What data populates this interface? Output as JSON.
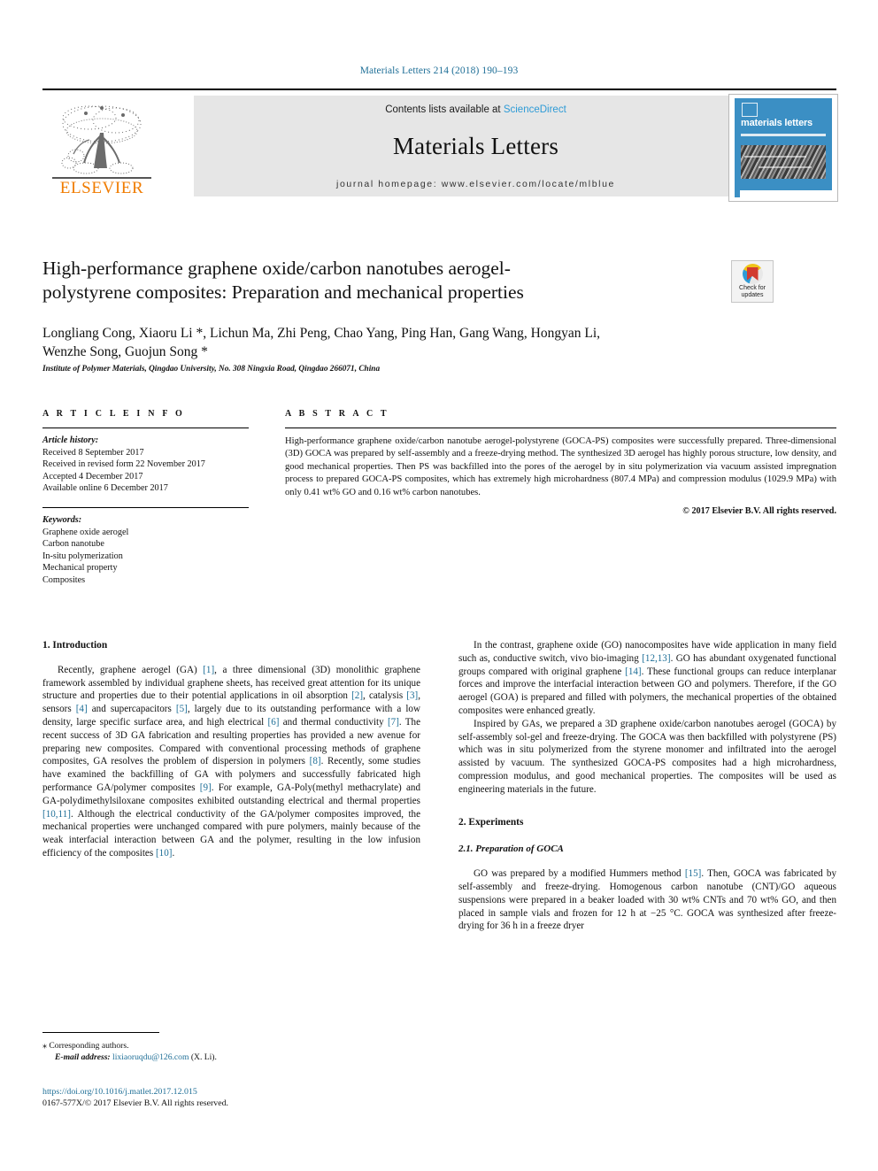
{
  "running_head": "Materials Letters 214 (2018) 190–193",
  "masthead": {
    "contents_prefix": "Contents lists available at ",
    "sciencedirect": "ScienceDirect",
    "journal_name": "Materials Letters",
    "homepage": "journal homepage: www.elsevier.com/locate/mlblue",
    "publisher_wordmark": "ELSEVIER",
    "cover_title": "materials letters",
    "accent_blue": "#2e9bd6",
    "elsevier_orange": "#f07c00"
  },
  "article": {
    "title_line1": "High-performance graphene oxide/carbon nanotubes aerogel-",
    "title_line2": "polystyrene composites: Preparation and mechanical properties",
    "authors_line1": "Longliang Cong, Xiaoru Li *, Lichun Ma, Zhi Peng, Chao Yang, Ping Han, Gang Wang, Hongyan Li,",
    "authors_line2": "Wenzhe Song, Guojun Song *",
    "affiliation": "Institute of Polymer Materials, Qingdao University, No. 308 Ningxia Road, Qingdao 266071, China",
    "crossmark_label_line1": "Check for",
    "crossmark_label_line2": "updates"
  },
  "article_info": {
    "heading": "A R T I C L E   I N F O",
    "history_label": "Article history:",
    "history": [
      "Received 8 September 2017",
      "Received in revised form 22 November 2017",
      "Accepted 4 December 2017",
      "Available online 6 December 2017"
    ],
    "keywords_label": "Keywords:",
    "keywords": [
      "Graphene oxide aerogel",
      "Carbon nanotube",
      "In-situ polymerization",
      "Mechanical property",
      "Composites"
    ]
  },
  "abstract": {
    "heading": "A B S T R A C T",
    "text": "High-performance graphene oxide/carbon nanotube aerogel-polystyrene (GOCA-PS) composites were successfully prepared. Three-dimensional (3D) GOCA was prepared by self-assembly and a freeze-drying method. The synthesized 3D aerogel has highly porous structure, low density, and good mechanical properties. Then PS was backfilled into the pores of the aerogel by in situ polymerization via vacuum assisted impregnation process to prepared GOCA-PS composites, which has extremely high microhardness (807.4 MPa) and compression modulus (1029.9 MPa) with only 0.41 wt% GO and 0.16 wt% carbon nanotubes.",
    "copyright": "© 2017 Elsevier B.V. All rights reserved."
  },
  "sections": {
    "intro_heading": "1. Introduction",
    "experiments_heading": "2. Experiments",
    "experiments_sub_heading": "2.1. Preparation of GOCA"
  },
  "body": {
    "left_p1_a": "Recently, graphene aerogel (GA) ",
    "left_p1_c1": "[1]",
    "left_p1_b": ", a three dimensional (3D) monolithic graphene framework assembled by individual graphene sheets, has received great attention for its unique structure and properties due to their potential applications in oil absorption ",
    "left_p1_c2": "[2]",
    "left_p1_d": ", catalysis ",
    "left_p1_c3": "[3]",
    "left_p1_e": ", sensors ",
    "left_p1_c4": "[4]",
    "left_p1_f": " and supercapacitors ",
    "left_p1_c5": "[5]",
    "left_p1_g": ", largely due to its outstanding performance with a low density, large specific surface area, and high electrical ",
    "left_p1_c6": "[6]",
    "left_p1_h": " and thermal conductivity ",
    "left_p1_c7": "[7]",
    "left_p1_i": ". The recent success of 3D GA fabrication and resulting properties has provided a new avenue for preparing new composites. Compared with conventional processing methods of graphene composites, GA resolves the problem of dispersion in polymers ",
    "left_p1_c8": "[8]",
    "left_p1_j": ". Recently, some studies have examined the backfilling of GA with polymers and successfully fabricated high performance GA/polymer composites ",
    "left_p1_c9": "[9]",
    "left_p1_k": ". For example, GA-Poly(methyl methacrylate) and GA-polydimethylsiloxane composites exhibited outstanding electrical and thermal properties ",
    "left_p1_c10": "[10,11]",
    "left_p1_l": ". Although the electrical conductivity of the GA/polymer composites improved, the mechanical properties were unchanged compared with pure polymers, mainly because of the weak interfacial interaction between GA and the polymer, resulting in the low infusion efficiency of the composites ",
    "left_p1_c11": "[10]",
    "left_p1_m": ".",
    "right_p1_a": "In the contrast, graphene oxide (GO) nanocomposites have wide application in many field such as, conductive switch, vivo bio-imaging ",
    "right_p1_c1": "[12,13]",
    "right_p1_b": ". GO has abundant oxygenated functional groups compared with original graphene ",
    "right_p1_c2": "[14]",
    "right_p1_c": ". These functional groups can reduce interplanar forces and improve the interfacial interaction between GO and polymers. Therefore, if the GO aerogel (GOA) is prepared and filled with polymers, the mechanical properties of the obtained composites were enhanced greatly.",
    "right_p2": "Inspired by GAs, we prepared a 3D graphene oxide/carbon nanotubes aerogel (GOCA) by self-assembly sol-gel and freeze-drying. The GOCA was then backfilled with polystyrene (PS) which was in situ polymerized from the styrene monomer and infiltrated into the aerogel assisted by vacuum. The synthesized GOCA-PS composites had a high microhardness, compression modulus, and good mechanical properties. The composites will be used as engineering materials in the future.",
    "right_p3_a": "GO was prepared by a modified Hummers method ",
    "right_p3_c1": "[15]",
    "right_p3_b": ". Then, GOCA was fabricated by self-assembly and freeze-drying. Homogenous carbon nanotube (CNT)/GO aqueous suspensions were prepared in a beaker loaded with 30 wt% CNTs and 70 wt% GO, and then placed in sample vials and frozen for 12 h at −25 °C. GOCA was synthesized after freeze-drying for 36 h in a freeze dryer"
  },
  "footnote": {
    "star": "⁎",
    "corresponding": " Corresponding authors.",
    "email_label": "E-mail address:",
    "email": "lixiaoruqdu@126.com",
    "email_suffix": " (X. Li)."
  },
  "footer": {
    "doi": "https://doi.org/10.1016/j.matlet.2017.12.015",
    "issn_line": "0167-577X/© 2017 Elsevier B.V. All rights reserved."
  }
}
